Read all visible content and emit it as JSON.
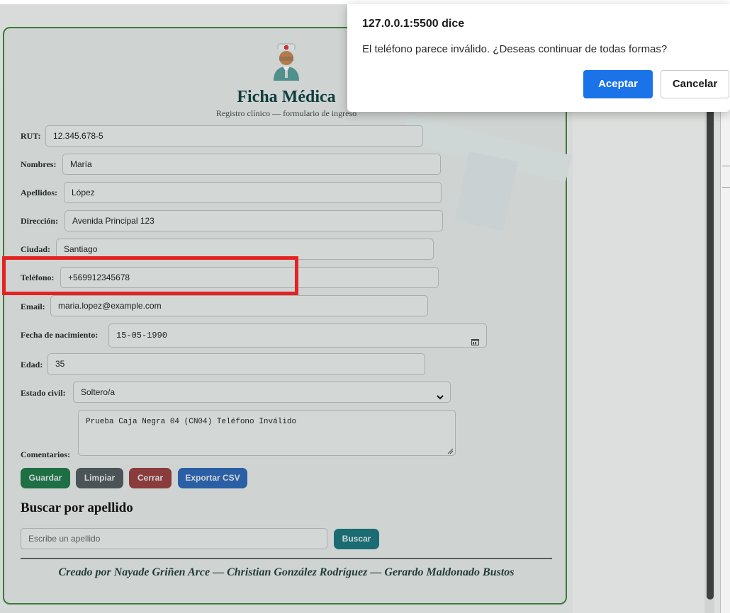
{
  "dialog": {
    "title": "127.0.0.1:5500 dice",
    "message": "El teléfono parece inválido. ¿Deseas continuar de todas formas?",
    "accept_label": "Aceptar",
    "cancel_label": "Cancelar"
  },
  "form": {
    "title": "Ficha Médica",
    "subtitle": "Registro clínico — formulario de ingreso",
    "header_icon": "doctor-icon",
    "fields": {
      "rut": {
        "label": "RUT:",
        "value": "12.345.678-5"
      },
      "nombres": {
        "label": "Nombres:",
        "value": "María"
      },
      "apellidos": {
        "label": "Apellidos:",
        "value": "López"
      },
      "direccion": {
        "label": "Dirección:",
        "value": "Avenida Principal 123"
      },
      "ciudad": {
        "label": "Ciudad:",
        "value": "Santiago"
      },
      "telefono": {
        "label": "Teléfono:",
        "value": "+569912345678"
      },
      "email": {
        "label": "Email:",
        "value": "maria.lopez@example.com"
      },
      "fecha": {
        "label": "Fecha de nacimiento:",
        "value": "15-05-1990"
      },
      "edad": {
        "label": "Edad:",
        "value": "35"
      },
      "estado_civil": {
        "label": "Estado civil:",
        "value": "Soltero/a"
      },
      "comentarios": {
        "label": "Comentarios:",
        "value": "Prueba Caja Negra 04 (CN04) Teléfono Inválido"
      }
    },
    "buttons": {
      "guardar": "Guardar",
      "limpiar": "Limpiar",
      "cerrar": "Cerrar",
      "exportar": "Exportar CSV"
    }
  },
  "search": {
    "title": "Buscar por apellido",
    "placeholder": "Escribe un apellido",
    "button_label": "Buscar"
  },
  "footer": {
    "credits": "Creado por Nayade Griñen Arce — Christian González Rodríguez — Gerardo Maldonado Bustos"
  },
  "colors": {
    "accent_green": "#3d7a3a",
    "btn_green": "#1e6f43",
    "btn_gray": "#4c5356",
    "btn_red": "#8a3b3b",
    "btn_blue": "#2b5fa5",
    "btn_teal": "#1a6b72",
    "dialog_primary": "#1a73e8",
    "highlight": "#e42222"
  }
}
